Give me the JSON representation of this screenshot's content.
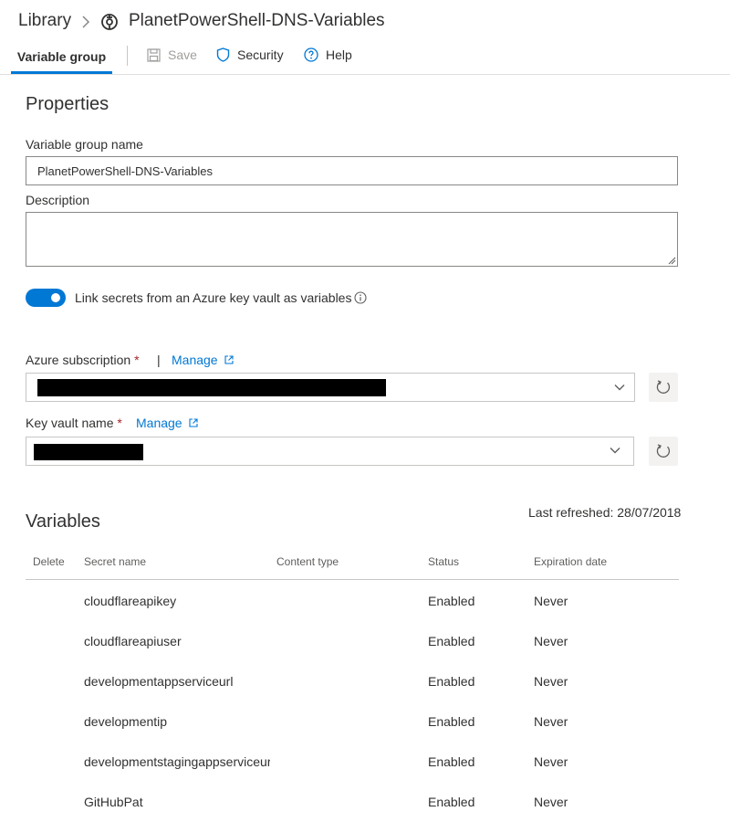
{
  "header": {
    "breadcrumb_root": "Library",
    "title": "PlanetPowerShell-DNS-Variables"
  },
  "tabs": {
    "active": "Variable group"
  },
  "toolbar": {
    "save": "Save",
    "security": "Security",
    "help": "Help"
  },
  "properties": {
    "title": "Properties",
    "group_name_label": "Variable group name",
    "group_name_value": "PlanetPowerShell-DNS-Variables",
    "description_label": "Description",
    "description_value": "",
    "link_toggle_label": "Link secrets from an Azure key vault as variables",
    "link_toggle_on": true,
    "azure_subscription_label": "Azure subscription",
    "key_vault_label": "Key vault name",
    "required_marker": "*",
    "pipe": "|",
    "manage_link": "Manage"
  },
  "variables": {
    "title": "Variables",
    "last_refreshed": "Last refreshed: 28/07/2018",
    "columns": {
      "delete": "Delete",
      "secret_name": "Secret name",
      "content_type": "Content type",
      "status": "Status",
      "expiration": "Expiration date"
    },
    "rows": [
      {
        "secret_name": "cloudflareapikey",
        "content_type": "",
        "status": "Enabled",
        "expiration": "Never"
      },
      {
        "secret_name": "cloudflareapiuser",
        "content_type": "",
        "status": "Enabled",
        "expiration": "Never"
      },
      {
        "secret_name": "developmentappserviceurl",
        "content_type": "",
        "status": "Enabled",
        "expiration": "Never"
      },
      {
        "secret_name": "developmentip",
        "content_type": "",
        "status": "Enabled",
        "expiration": "Never"
      },
      {
        "secret_name": "developmentstagingappserviceurl",
        "content_type": "",
        "status": "Enabled",
        "expiration": "Never"
      },
      {
        "secret_name": "GitHubPat",
        "content_type": "",
        "status": "Enabled",
        "expiration": "Never"
      }
    ]
  },
  "colors": {
    "accent": "#0078d4",
    "required": "#a4262c",
    "disabled_text": "#a19f9d"
  },
  "icons": {
    "breadcrumb_separator": "chevron-right-icon",
    "variable_group": "variable-group-icon",
    "save": "save-icon",
    "security": "shield-icon",
    "help": "help-icon",
    "info": "info-icon",
    "external_link": "external-link-icon",
    "dropdown": "chevron-down-icon",
    "refresh": "refresh-icon"
  }
}
